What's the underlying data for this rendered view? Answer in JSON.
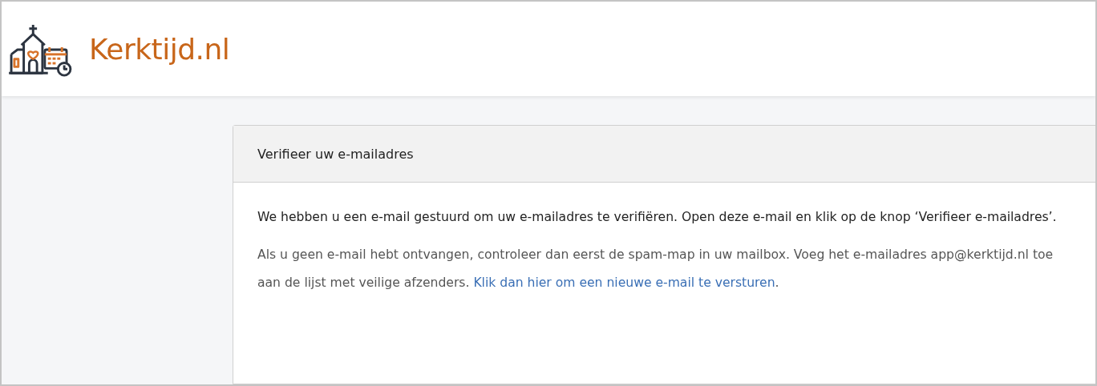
{
  "header": {
    "site_name": "Kerktijd.nl"
  },
  "card": {
    "title": "Verifieer uw e-mailadres",
    "intro": "We hebben u een e-mail gestuurd om uw e-mailadres te verifiëren. Open deze e-mail en klik op de knop ‘Verifieer e-mailadres’.",
    "help_text": "Als u geen e-mail hebt ontvangen, controleer dan eerst de spam-map in uw mailbox. Voeg het e-mailadres app@kerktijd.nl toe aan de lijst met veilige afzenders.",
    "resend_link": "Klik dan hier om een nieuwe e-mail te versturen",
    "help_end": "."
  }
}
